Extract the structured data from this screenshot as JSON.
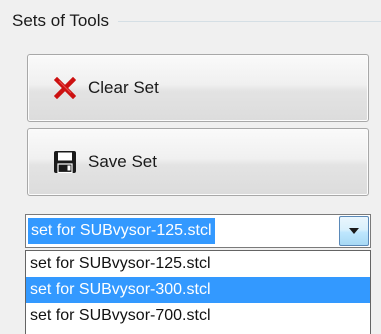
{
  "group": {
    "title": "Sets of Tools"
  },
  "buttons": {
    "clear_label": "Clear Set",
    "save_label": "Save Set"
  },
  "icons": {
    "clear": "red-x-icon",
    "save": "floppy-disk-icon",
    "dropdown_arrow": "chevron-down-icon"
  },
  "combo": {
    "selected_value": "set for SUBvysor-125.stcl",
    "options": [
      "set for SUBvysor-125.stcl",
      "set for SUBvysor-300.stcl",
      "set for SUBvysor-700.stcl"
    ],
    "highlighted_index": 1
  },
  "colors": {
    "selection": "#3399ff",
    "clear_icon": "#cc1111",
    "save_icon": "#1a1a1a"
  }
}
